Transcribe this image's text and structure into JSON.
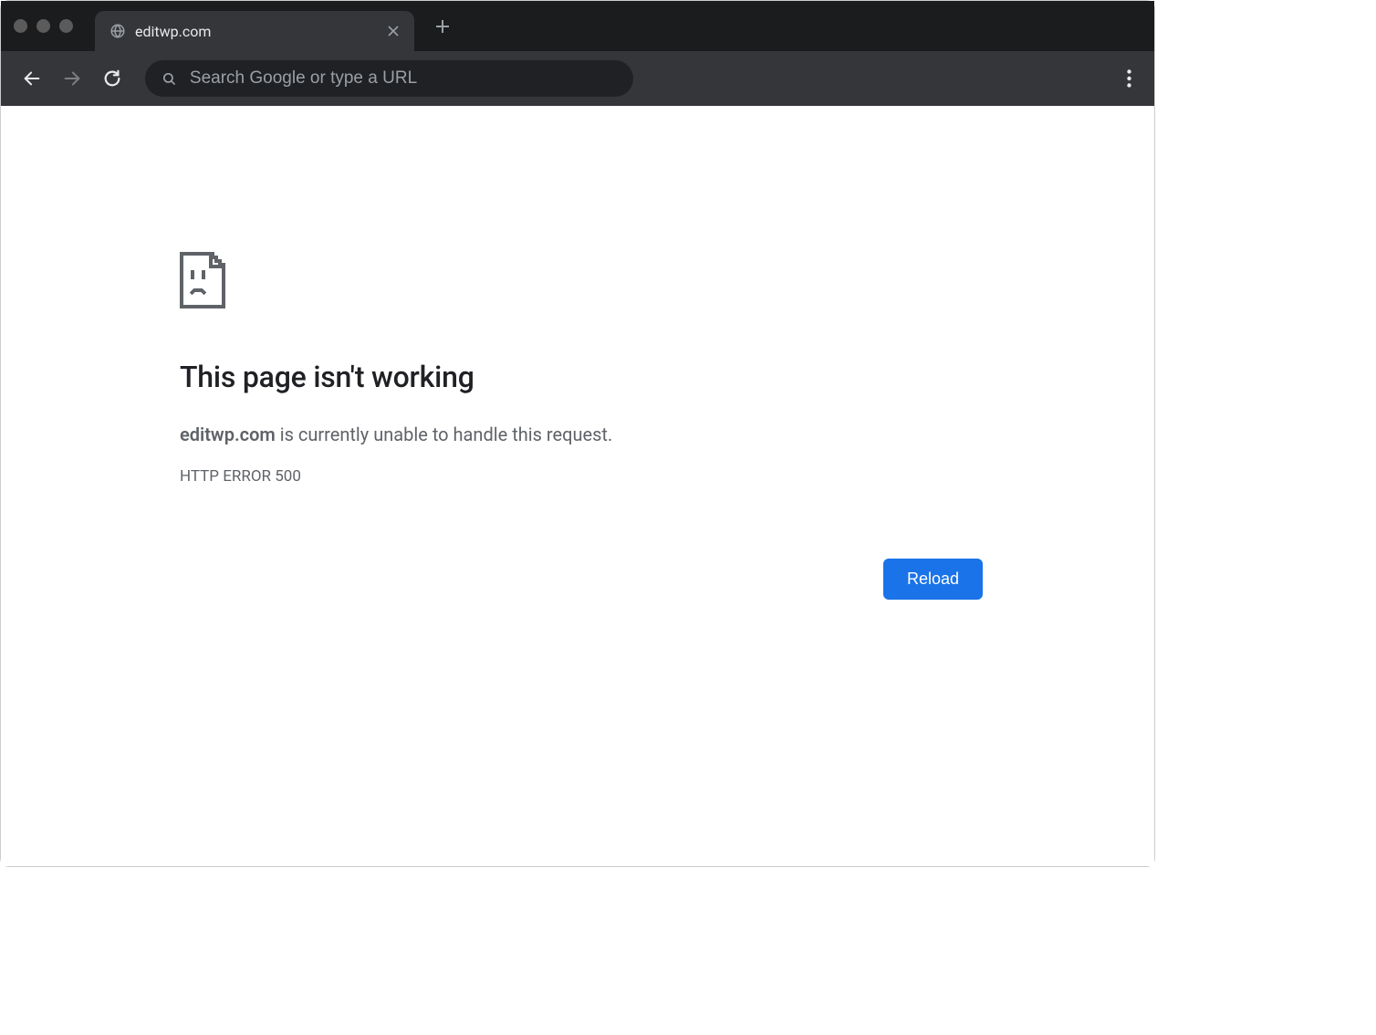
{
  "chrome": {
    "tab": {
      "title": "editwp.com"
    },
    "omnibox": {
      "placeholder": "Search Google or type a URL",
      "value": ""
    }
  },
  "page": {
    "heading": "This page isn't working",
    "domain": "editwp.com",
    "message_suffix": " is currently unable to handle this request.",
    "error_code": "HTTP ERROR 500",
    "reload_label": "Reload"
  }
}
